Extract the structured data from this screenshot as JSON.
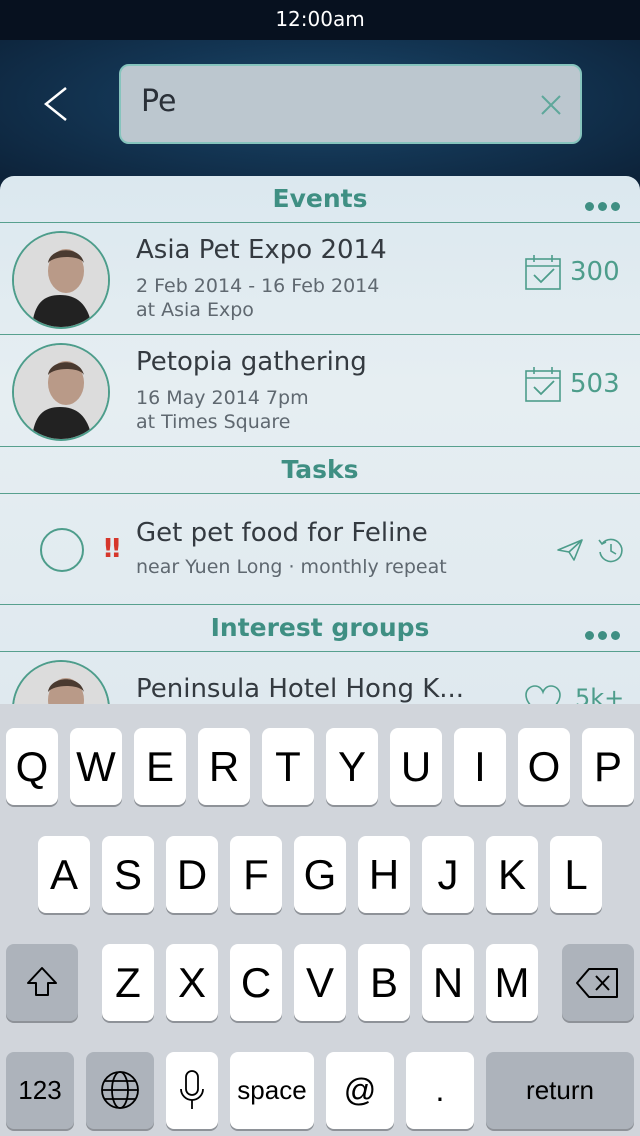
{
  "status": {
    "time": "12:00am"
  },
  "search": {
    "value": "Pe"
  },
  "events": {
    "title": "Events",
    "items": [
      {
        "title": "Asia Pet Expo 2014",
        "date": "2 Feb 2014 - 16 Feb 2014",
        "location": "at Asia Expo",
        "count": "300"
      },
      {
        "title": "Petopia gathering",
        "date": "16 May 2014 7pm",
        "location": "at Times Square",
        "count": "503"
      }
    ]
  },
  "tasks": {
    "title": "Tasks",
    "items": [
      {
        "priority": "‼",
        "title": "Get pet food for Feline",
        "meta": "near Yuen Long · monthly repeat"
      }
    ]
  },
  "groups": {
    "title": "Interest groups",
    "items": [
      {
        "title": "Peninsula Hotel Hong K...",
        "count": "5k+"
      }
    ]
  },
  "keyboard": {
    "row1": [
      "Q",
      "W",
      "E",
      "R",
      "T",
      "Y",
      "U",
      "I",
      "O",
      "P"
    ],
    "row2": [
      "A",
      "S",
      "D",
      "F",
      "G",
      "H",
      "J",
      "K",
      "L"
    ],
    "row3": [
      "Z",
      "X",
      "C",
      "V",
      "B",
      "N",
      "M"
    ],
    "numbers": "123",
    "space": "space",
    "at": "@",
    "period": ".",
    "return": "return"
  },
  "colors": {
    "accent": "#3f8f83",
    "priority": "#d6362b"
  }
}
